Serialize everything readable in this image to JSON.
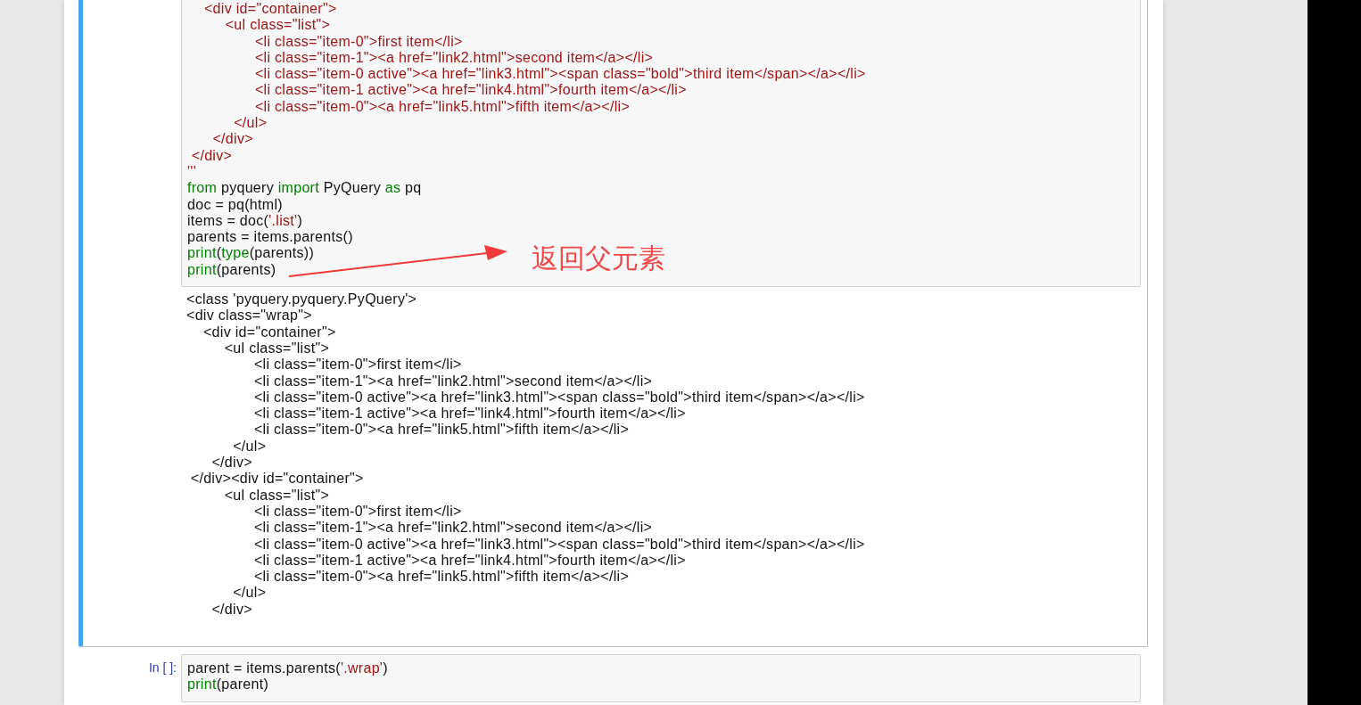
{
  "cells": [
    {
      "selected": true,
      "input": [
        [
          {
            "kind": "string",
            "text": "    <div id=\"container\">"
          }
        ],
        [
          {
            "kind": "string",
            "text": "         <ul class=\"list\">"
          }
        ],
        [
          {
            "kind": "string",
            "text": "                <li class=\"item-0\">first item</li>"
          }
        ],
        [
          {
            "kind": "string",
            "text": "                <li class=\"item-1\"><a href=\"link2.html\">second item</a></li>"
          }
        ],
        [
          {
            "kind": "string",
            "text": "                <li class=\"item-0 active\"><a href=\"link3.html\"><span class=\"bold\">third item</span></a></li>"
          }
        ],
        [
          {
            "kind": "string",
            "text": "                <li class=\"item-1 active\"><a href=\"link4.html\">fourth item</a></li>"
          }
        ],
        [
          {
            "kind": "string",
            "text": "                <li class=\"item-0\"><a href=\"link5.html\">fifth item</a></li>"
          }
        ],
        [
          {
            "kind": "string",
            "text": "           </ul>"
          }
        ],
        [
          {
            "kind": "string",
            "text": "      </div>"
          }
        ],
        [
          {
            "kind": "string",
            "text": " </div>"
          }
        ],
        [
          {
            "kind": "string",
            "text": "'''"
          }
        ],
        [
          {
            "kind": "keyword",
            "text": "from"
          },
          {
            "kind": "plain",
            "text": " pyquery "
          },
          {
            "kind": "keyword",
            "text": "import"
          },
          {
            "kind": "plain",
            "text": " PyQuery "
          },
          {
            "kind": "keyword",
            "text": "as"
          },
          {
            "kind": "plain",
            "text": " pq"
          }
        ],
        [
          {
            "kind": "plain",
            "text": "doc = pq(html)"
          }
        ],
        [
          {
            "kind": "plain",
            "text": "items = doc("
          },
          {
            "kind": "string",
            "text": "'.list'"
          },
          {
            "kind": "plain",
            "text": ")"
          }
        ],
        [
          {
            "kind": "plain",
            "text": "parents = items.parents()"
          }
        ],
        [
          {
            "kind": "builtin",
            "text": "print"
          },
          {
            "kind": "plain",
            "text": "("
          },
          {
            "kind": "builtin",
            "text": "type"
          },
          {
            "kind": "plain",
            "text": "(parents))"
          }
        ],
        [
          {
            "kind": "builtin",
            "text": "print"
          },
          {
            "kind": "plain",
            "text": "(parents)"
          }
        ]
      ],
      "annotation": {
        "text": "返回父元素"
      },
      "output": [
        "<class 'pyquery.pyquery.PyQuery'>",
        "<div class=\"wrap\">",
        "    <div id=\"container\">",
        "         <ul class=\"list\">",
        "                <li class=\"item-0\">first item</li>",
        "                <li class=\"item-1\"><a href=\"link2.html\">second item</a></li>",
        "                <li class=\"item-0 active\"><a href=\"link3.html\"><span class=\"bold\">third item</span></a></li>",
        "                <li class=\"item-1 active\"><a href=\"link4.html\">fourth item</a></li>",
        "                <li class=\"item-0\"><a href=\"link5.html\">fifth item</a></li>",
        "           </ul>",
        "      </div>",
        " </div><div id=\"container\">",
        "         <ul class=\"list\">",
        "                <li class=\"item-0\">first item</li>",
        "                <li class=\"item-1\"><a href=\"link2.html\">second item</a></li>",
        "                <li class=\"item-0 active\"><a href=\"link3.html\"><span class=\"bold\">third item</span></a></li>",
        "                <li class=\"item-1 active\"><a href=\"link4.html\">fourth item</a></li>",
        "                <li class=\"item-0\"><a href=\"link5.html\">fifth item</a></li>",
        "           </ul>",
        "      </div>"
      ]
    },
    {
      "selected": false,
      "prompt": "In [ ]:",
      "input": [
        [
          {
            "kind": "plain",
            "text": "parent = items.parents("
          },
          {
            "kind": "string",
            "text": "'.wrap'"
          },
          {
            "kind": "plain",
            "text": ")"
          }
        ],
        [
          {
            "kind": "builtin",
            "text": "print"
          },
          {
            "kind": "plain",
            "text": "(parent)"
          }
        ]
      ]
    }
  ]
}
